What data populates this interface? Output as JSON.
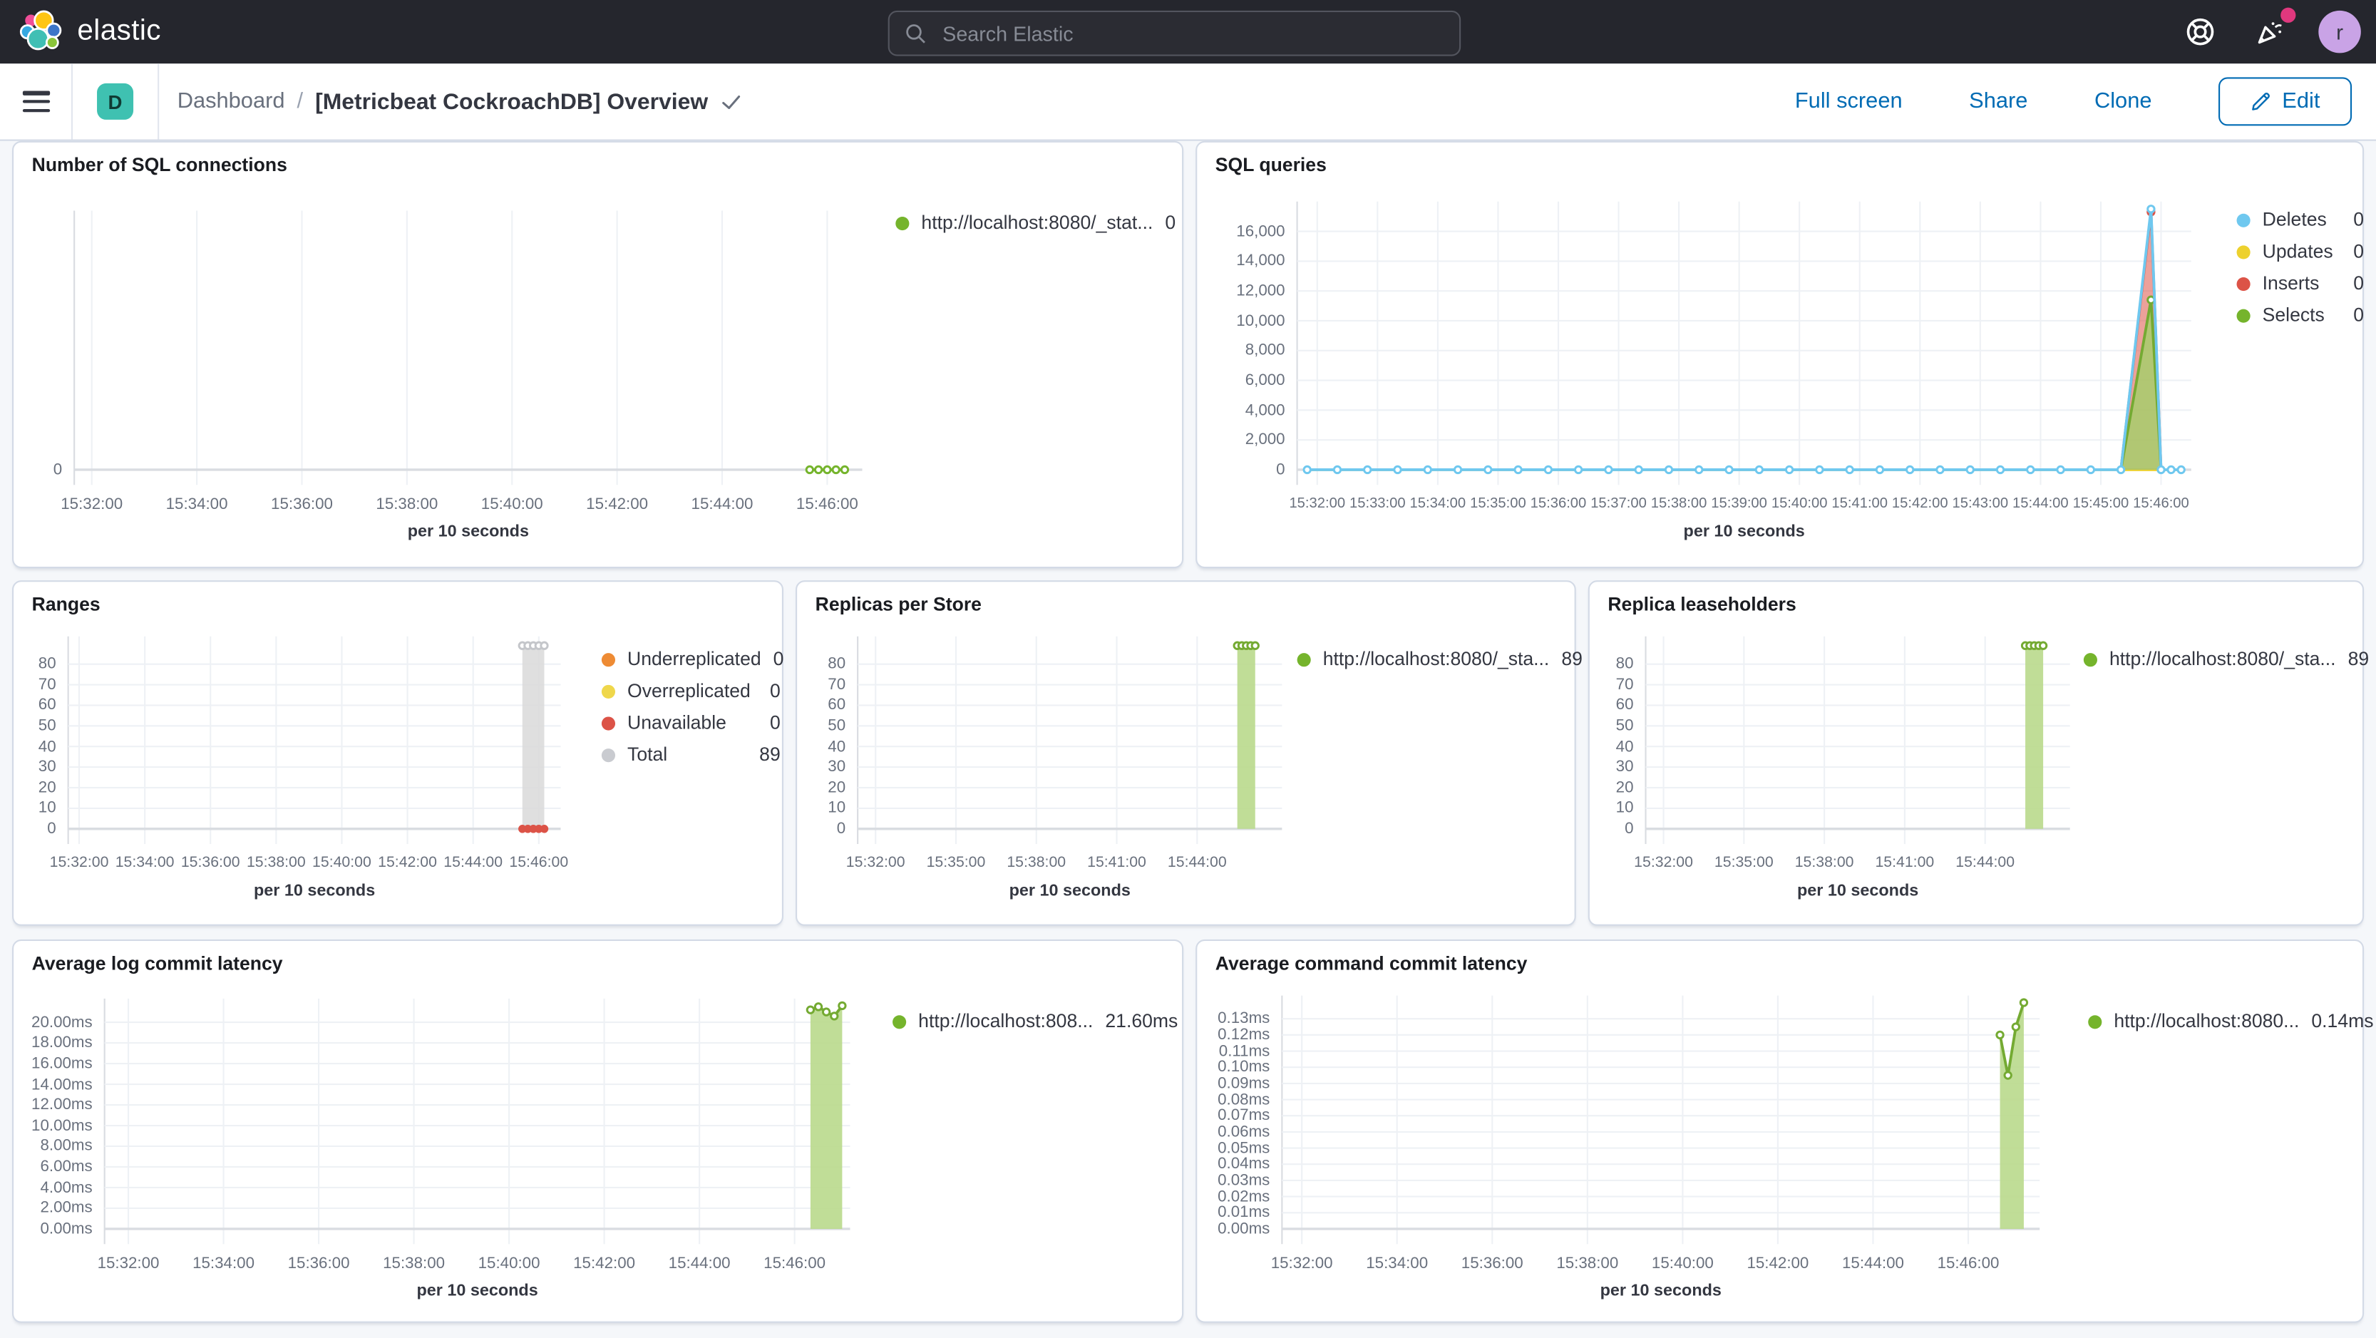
{
  "header": {
    "logo_text": "elastic",
    "search_placeholder": "Search Elastic",
    "avatar_initial": "r"
  },
  "nav": {
    "badge_letter": "D",
    "breadcrumb": "Dashboard",
    "separator": "/",
    "title": "[Metricbeat CockroachDB] Overview",
    "actions": {
      "full_screen": "Full screen",
      "share": "Share",
      "clone": "Clone",
      "edit": "Edit"
    }
  },
  "colors": {
    "header_bg": "#25262d",
    "link_blue": "#006bb4",
    "badge_teal": "#3fc1b1",
    "avatar_purple": "#c9a3e6",
    "notification_pink": "#e0387e",
    "series_green": "#75b42c",
    "series_blue": "#6fc8ef",
    "series_yellow": "#edd12e",
    "series_red": "#dc5347",
    "series_orange": "#ee8b34",
    "series_gray": "#c9cbd0"
  },
  "chart_data": [
    {
      "type": "line",
      "title": "Number of SQL connections",
      "axis_title": "per 10 seconds",
      "x_domain": [
        "15:31:40",
        "15:46:40"
      ],
      "x_ticks": [
        "15:32:00",
        "15:34:00",
        "15:36:00",
        "15:38:00",
        "15:40:00",
        "15:42:00",
        "15:44:00",
        "15:46:00"
      ],
      "y_ticks": [
        {
          "v": 0,
          "label": "0"
        }
      ],
      "y_max": 10,
      "series": [
        {
          "name": "http://localhost:8080/_stat...",
          "kind": "line",
          "color": "#75b42c",
          "markers": "all",
          "points": [
            [
              "15:45:40",
              0
            ],
            [
              "15:45:50",
              0
            ],
            [
              "15:46:00",
              0
            ],
            [
              "15:46:10",
              0
            ],
            [
              "15:46:20",
              0
            ]
          ]
        }
      ],
      "legend": {
        "items": [
          {
            "color": "#75b42c",
            "label": "http://localhost:8080/_stat...",
            "value": "0"
          }
        ]
      }
    },
    {
      "type": "line",
      "title": "SQL queries",
      "axis_title": "per 10 seconds",
      "x_domain": [
        "15:31:40",
        "15:46:30"
      ],
      "x_ticks": [
        "15:32:00",
        "15:33:00",
        "15:34:00",
        "15:35:00",
        "15:36:00",
        "15:37:00",
        "15:38:00",
        "15:39:00",
        "15:40:00",
        "15:41:00",
        "15:42:00",
        "15:43:00",
        "15:44:00",
        "15:45:00",
        "15:46:00"
      ],
      "y_ticks": [
        {
          "v": 0,
          "label": "0"
        },
        {
          "v": 2000,
          "label": "2,000"
        },
        {
          "v": 4000,
          "label": "4,000"
        },
        {
          "v": 6000,
          "label": "6,000"
        },
        {
          "v": 8000,
          "label": "8,000"
        },
        {
          "v": 10000,
          "label": "10,000"
        },
        {
          "v": 12000,
          "label": "12,000"
        },
        {
          "v": 14000,
          "label": "14,000"
        },
        {
          "v": 16000,
          "label": "16,000"
        }
      ],
      "y_max": 17800,
      "series": [
        {
          "name": "Updates",
          "kind": "line",
          "color": "#edd12e",
          "markers": "none",
          "points": [
            [
              "15:31:50",
              0
            ],
            [
              "15:45:20",
              0
            ],
            [
              "15:46:20",
              0
            ]
          ]
        },
        {
          "name": "Inserts",
          "kind": "area",
          "color": "#dc5347",
          "fill": "#dc5347",
          "fill_opacity": 0.55,
          "markers": "peaks",
          "points": [
            [
              "15:45:20",
              0
            ],
            [
              "15:45:50",
              17300
            ],
            [
              "15:46:00",
              0
            ]
          ]
        },
        {
          "name": "Selects",
          "kind": "area",
          "color": "#74aa32",
          "fill": "#a7ce6c",
          "fill_opacity": 0.85,
          "markers": "peaks",
          "points": [
            [
              "15:45:20",
              0
            ],
            [
              "15:45:50",
              11400
            ],
            [
              "15:46:00",
              0
            ]
          ]
        },
        {
          "name": "Deletes",
          "kind": "line",
          "color": "#6fc8ef",
          "markers": "all",
          "points": [
            [
              "15:31:50",
              0
            ],
            [
              "15:32:20",
              0
            ],
            [
              "15:32:50",
              0
            ],
            [
              "15:33:20",
              0
            ],
            [
              "15:33:50",
              0
            ],
            [
              "15:34:20",
              0
            ],
            [
              "15:34:50",
              0
            ],
            [
              "15:35:20",
              0
            ],
            [
              "15:35:50",
              0
            ],
            [
              "15:36:20",
              0
            ],
            [
              "15:36:50",
              0
            ],
            [
              "15:37:20",
              0
            ],
            [
              "15:37:50",
              0
            ],
            [
              "15:38:20",
              0
            ],
            [
              "15:38:50",
              0
            ],
            [
              "15:39:20",
              0
            ],
            [
              "15:39:50",
              0
            ],
            [
              "15:40:20",
              0
            ],
            [
              "15:40:50",
              0
            ],
            [
              "15:41:20",
              0
            ],
            [
              "15:41:50",
              0
            ],
            [
              "15:42:20",
              0
            ],
            [
              "15:42:50",
              0
            ],
            [
              "15:43:20",
              0
            ],
            [
              "15:43:50",
              0
            ],
            [
              "15:44:20",
              0
            ],
            [
              "15:44:50",
              0
            ],
            [
              "15:45:20",
              0
            ],
            [
              "15:45:50",
              17500
            ],
            [
              "15:46:00",
              0
            ],
            [
              "15:46:10",
              0
            ],
            [
              "15:46:20",
              0
            ]
          ]
        }
      ],
      "legend": {
        "items": [
          {
            "color": "#6fc8ef",
            "label": "Deletes",
            "value": "0"
          },
          {
            "color": "#edd12e",
            "label": "Updates",
            "value": "0"
          },
          {
            "color": "#dc5347",
            "label": "Inserts",
            "value": "0"
          },
          {
            "color": "#75b42c",
            "label": "Selects",
            "value": "0"
          }
        ]
      }
    },
    {
      "type": "bar",
      "title": "Ranges",
      "axis_title": "per 10 seconds",
      "x_domain": [
        "15:31:40",
        "15:46:40"
      ],
      "x_ticks": [
        "15:32:00",
        "15:34:00",
        "15:36:00",
        "15:38:00",
        "15:40:00",
        "15:42:00",
        "15:44:00",
        "15:46:00"
      ],
      "y_ticks": [
        {
          "v": 0,
          "label": "0"
        },
        {
          "v": 10,
          "label": "10"
        },
        {
          "v": 20,
          "label": "20"
        },
        {
          "v": 30,
          "label": "30"
        },
        {
          "v": 40,
          "label": "40"
        },
        {
          "v": 50,
          "label": "50"
        },
        {
          "v": 60,
          "label": "60"
        },
        {
          "v": 70,
          "label": "70"
        },
        {
          "v": 80,
          "label": "80"
        }
      ],
      "y_max": 92,
      "series": [
        {
          "name": "Total",
          "kind": "bar",
          "fill": "#d9d9d9",
          "opacity": 0.85,
          "x0": "15:45:30",
          "x1": "15:46:10",
          "v": 89,
          "top_markers": {
            "color": "#c4c6ca",
            "times": [
              "15:45:30",
              "15:45:40",
              "15:45:50",
              "15:46:00",
              "15:46:10"
            ]
          }
        },
        {
          "name": "Unavailable",
          "kind": "dots",
          "color": "#dc5347",
          "v": 0,
          "times": [
            "15:45:30",
            "15:45:40",
            "15:45:50",
            "15:46:00",
            "15:46:10"
          ]
        }
      ],
      "legend": {
        "items": [
          {
            "color": "#ee8b34",
            "label": "Underreplicated",
            "value": "0"
          },
          {
            "color": "#efd74b",
            "label": "Overreplicated",
            "value": "0"
          },
          {
            "color": "#dc5347",
            "label": "Unavailable",
            "value": "0"
          },
          {
            "color": "#c9cbd0",
            "label": "Total",
            "value": "89"
          }
        ]
      }
    },
    {
      "type": "bar",
      "title": "Replicas per Store",
      "axis_title": "per 10 seconds",
      "x_domain": [
        "15:31:20",
        "15:47:10"
      ],
      "x_ticks": [
        "15:32:00",
        "15:35:00",
        "15:38:00",
        "15:41:00",
        "15:44:00"
      ],
      "y_ticks": [
        {
          "v": 0,
          "label": "0"
        },
        {
          "v": 10,
          "label": "10"
        },
        {
          "v": 20,
          "label": "20"
        },
        {
          "v": 30,
          "label": "30"
        },
        {
          "v": 40,
          "label": "40"
        },
        {
          "v": 50,
          "label": "50"
        },
        {
          "v": 60,
          "label": "60"
        },
        {
          "v": 70,
          "label": "70"
        },
        {
          "v": 80,
          "label": "80"
        }
      ],
      "y_max": 92,
      "series": [
        {
          "name": "http://localhost:8080/_sta...",
          "kind": "bar",
          "fill": "#b9d98c",
          "opacity": 0.9,
          "x0": "15:45:30",
          "x1": "15:46:10",
          "v": 89,
          "top_markers": {
            "color": "#74aa32",
            "times": [
              "15:45:30",
              "15:45:40",
              "15:45:50",
              "15:46:00",
              "15:46:10"
            ]
          }
        }
      ],
      "legend": {
        "items": [
          {
            "color": "#75b42c",
            "label": "http://localhost:8080/_sta...",
            "value": "89"
          }
        ]
      }
    },
    {
      "type": "bar",
      "title": "Replica leaseholders",
      "axis_title": "per 10 seconds",
      "x_domain": [
        "15:31:20",
        "15:47:10"
      ],
      "x_ticks": [
        "15:32:00",
        "15:35:00",
        "15:38:00",
        "15:41:00",
        "15:44:00"
      ],
      "y_ticks": [
        {
          "v": 0,
          "label": "0"
        },
        {
          "v": 10,
          "label": "10"
        },
        {
          "v": 20,
          "label": "20"
        },
        {
          "v": 30,
          "label": "30"
        },
        {
          "v": 40,
          "label": "40"
        },
        {
          "v": 50,
          "label": "50"
        },
        {
          "v": 60,
          "label": "60"
        },
        {
          "v": 70,
          "label": "70"
        },
        {
          "v": 80,
          "label": "80"
        }
      ],
      "y_max": 92,
      "series": [
        {
          "name": "http://localhost:8080/_sta...",
          "kind": "bar",
          "fill": "#b9d98c",
          "opacity": 0.9,
          "x0": "15:45:30",
          "x1": "15:46:10",
          "v": 89,
          "top_markers": {
            "color": "#74aa32",
            "times": [
              "15:45:30",
              "15:45:40",
              "15:45:50",
              "15:46:00",
              "15:46:10"
            ]
          }
        }
      ],
      "legend": {
        "items": [
          {
            "color": "#75b42c",
            "label": "http://localhost:8080/_sta...",
            "value": "89"
          }
        ]
      }
    },
    {
      "type": "area",
      "title": "Average log commit latency",
      "axis_title": "per 10 seconds",
      "x_domain": [
        "15:31:30",
        "15:47:10"
      ],
      "x_ticks": [
        "15:32:00",
        "15:34:00",
        "15:36:00",
        "15:38:00",
        "15:40:00",
        "15:42:00",
        "15:44:00",
        "15:46:00"
      ],
      "y_ticks": [
        {
          "v": 0,
          "label": "0.00ms"
        },
        {
          "v": 2,
          "label": "2.00ms"
        },
        {
          "v": 4,
          "label": "4.00ms"
        },
        {
          "v": 6,
          "label": "6.00ms"
        },
        {
          "v": 8,
          "label": "8.00ms"
        },
        {
          "v": 10,
          "label": "10.00ms"
        },
        {
          "v": 12,
          "label": "12.00ms"
        },
        {
          "v": 14,
          "label": "14.00ms"
        },
        {
          "v": 16,
          "label": "16.00ms"
        },
        {
          "v": 18,
          "label": "18.00ms"
        },
        {
          "v": 20,
          "label": "20.00ms"
        }
      ],
      "y_max": 22,
      "series": [
        {
          "name": "http://localhost:808...",
          "kind": "area",
          "color": "#74aa32",
          "fill": "#b9d98c",
          "fill_opacity": 0.9,
          "markers": "all",
          "points": [
            [
              "15:46:20",
              21.2
            ],
            [
              "15:46:30",
              21.5
            ],
            [
              "15:46:40",
              21.0
            ],
            [
              "15:46:50",
              20.6
            ],
            [
              "15:47:00",
              21.6
            ]
          ]
        }
      ],
      "legend": {
        "items": [
          {
            "color": "#75b42c",
            "label": "http://localhost:808...",
            "value": "21.60ms"
          }
        ]
      }
    },
    {
      "type": "area",
      "title": "Average command commit latency",
      "axis_title": "per 10 seconds",
      "x_domain": [
        "15:31:35",
        "15:47:30"
      ],
      "x_ticks": [
        "15:32:00",
        "15:34:00",
        "15:36:00",
        "15:38:00",
        "15:40:00",
        "15:42:00",
        "15:44:00",
        "15:46:00"
      ],
      "y_ticks": [
        {
          "v": 0,
          "label": "0.00ms"
        },
        {
          "v": 0.01,
          "label": "0.01ms"
        },
        {
          "v": 0.02,
          "label": "0.02ms"
        },
        {
          "v": 0.03,
          "label": "0.03ms"
        },
        {
          "v": 0.04,
          "label": "0.04ms"
        },
        {
          "v": 0.05,
          "label": "0.05ms"
        },
        {
          "v": 0.06,
          "label": "0.06ms"
        },
        {
          "v": 0.07,
          "label": "0.07ms"
        },
        {
          "v": 0.08,
          "label": "0.08ms"
        },
        {
          "v": 0.09,
          "label": "0.09ms"
        },
        {
          "v": 0.1,
          "label": "0.10ms"
        },
        {
          "v": 0.11,
          "label": "0.11ms"
        },
        {
          "v": 0.12,
          "label": "0.12ms"
        },
        {
          "v": 0.13,
          "label": "0.13ms"
        }
      ],
      "y_max": 0.1425,
      "series": [
        {
          "name": "http://localhost:8080...",
          "kind": "area",
          "color": "#74aa32",
          "fill": "#b9d98c",
          "fill_opacity": 0.9,
          "markers": "all",
          "points": [
            [
              "15:46:40",
              0.12
            ],
            [
              "15:46:50",
              0.095
            ],
            [
              "15:47:00",
              0.125
            ],
            [
              "15:47:10",
              0.14
            ]
          ]
        }
      ],
      "legend": {
        "items": [
          {
            "color": "#75b42c",
            "label": "http://localhost:8080...",
            "value": "0.14ms"
          }
        ]
      }
    }
  ]
}
